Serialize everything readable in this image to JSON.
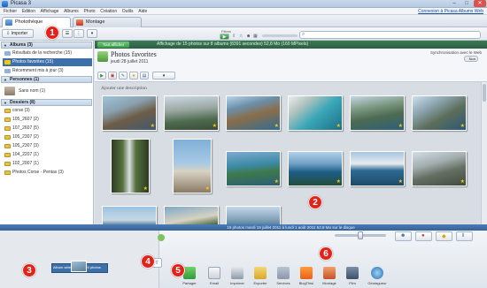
{
  "window": {
    "title": "Picasa 3"
  },
  "menu": {
    "items": [
      "Fichier",
      "Edition",
      "Affichage",
      "Albums",
      "Photo",
      "Création",
      "Outils",
      "Aide"
    ],
    "account_link": "Connexion à Picasa Albums Web"
  },
  "tabs": [
    {
      "label": "Photothèque",
      "active": true
    },
    {
      "label": "Montage",
      "active": false
    }
  ],
  "toolbar": {
    "import_label": "Importer",
    "filter_label": "Filtres"
  },
  "badges": [
    "1",
    "2",
    "3",
    "4",
    "5",
    "6"
  ],
  "sidebar": {
    "sections": [
      {
        "label": "Albums (3)",
        "items": [
          {
            "label": "Résultats de la recherche (15)",
            "selected": false
          },
          {
            "label": "Photos favorites (15)",
            "selected": true
          },
          {
            "label": "Récemment mis à jour (3)",
            "selected": false
          }
        ]
      },
      {
        "label": "Personnes (1)",
        "items": [
          {
            "label": "Sans nom (1)",
            "selected": false
          }
        ]
      },
      {
        "label": "Dossiers (8)",
        "items": [
          {
            "label": "corse (3)",
            "selected": false
          },
          {
            "label": "105_2607 (2)",
            "selected": false
          },
          {
            "label": "107_2607 (5)",
            "selected": false
          },
          {
            "label": "105_2307 (2)",
            "selected": false
          },
          {
            "label": "105_2307 (3)",
            "selected": false
          },
          {
            "label": "104_2207 (1)",
            "selected": false
          },
          {
            "label": "102_2007 (1)",
            "selected": false
          },
          {
            "label": "Photos Corse - Pentax (3)",
            "selected": false
          }
        ]
      }
    ]
  },
  "green_bar": {
    "button": "Tout afficher",
    "text": "Affichage de 15 photos sur 8 albums (8391 secondes) 52,8 Mo (160 MPixels)"
  },
  "album": {
    "title": "Photos favorites",
    "date": "jeudi 28 juillet 2011",
    "description_placeholder": "Ajouter une description",
    "sync_label": "Synchronisation avec le Web",
    "sync_state": "Non"
  },
  "status": {
    "text": "15 photos    mardi 19 juillet 2011 à lundi 1 août 2011    52,8 Mo sur le disque"
  },
  "tray": {
    "label": "Album sélectionné - 15 photos"
  },
  "bottom_actions": [
    "Partager",
    "Email",
    "Imprimer",
    "Exporter",
    "Services",
    "BlogThis!",
    "Montage",
    "Film",
    "Géotagueur"
  ],
  "colors": {
    "accent": "#3d6fa8",
    "green": "#2d5f43",
    "badge": "#e2231a",
    "star": "#f3c614"
  }
}
